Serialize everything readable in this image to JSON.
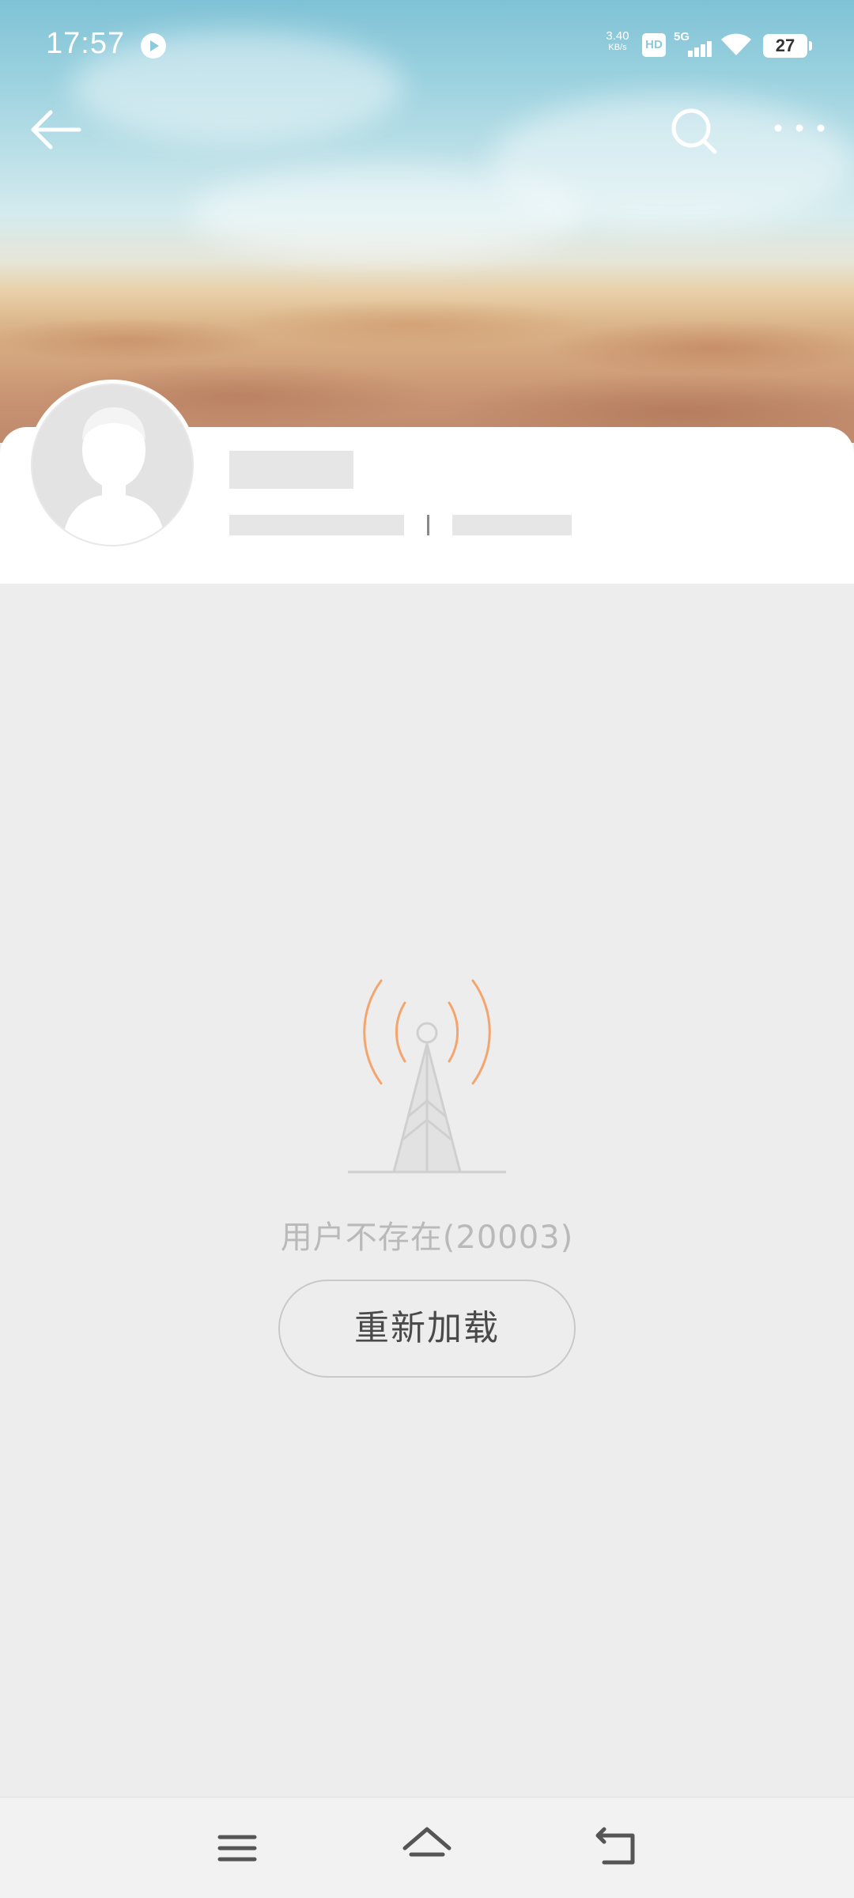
{
  "status_bar": {
    "time": "17:57",
    "network_speed": "3.40",
    "network_speed_unit": "KB/s",
    "hd_label": "HD",
    "signal_label": "5G",
    "battery": "27",
    "play-icon": "play-circle-icon",
    "wifi-icon": "wifi-icon"
  },
  "top_nav": {
    "back_icon": "back-arrow-icon",
    "search_icon": "search-icon",
    "more_icon": "more-dots-icon"
  },
  "profile": {
    "avatar_icon": "default-avatar-icon"
  },
  "empty_state": {
    "icon": "signal-tower-icon",
    "message": "用户不存在(20003)",
    "reload_label": "重新加载",
    "accent_color": "#f4a56e"
  },
  "bottom_nav": {
    "menu_icon": "menu-icon",
    "home_icon": "home-icon",
    "back_icon": "return-icon"
  }
}
